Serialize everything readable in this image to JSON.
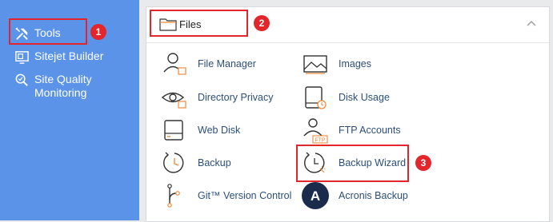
{
  "sidebar": {
    "items": [
      {
        "label": "Tools",
        "icon": "tools-icon"
      },
      {
        "label": "Sitejet Builder",
        "icon": "sitejet-icon"
      },
      {
        "label": "Site Quality Monitoring",
        "icon": "site-quality-icon"
      }
    ]
  },
  "panel": {
    "title": "Files",
    "tools_left": [
      {
        "label": "File Manager",
        "icon": "file-manager-icon"
      },
      {
        "label": "Directory Privacy",
        "icon": "directory-privacy-icon"
      },
      {
        "label": "Web Disk",
        "icon": "web-disk-icon"
      },
      {
        "label": "Backup",
        "icon": "backup-icon"
      },
      {
        "label": "Git™ Version Control",
        "icon": "git-icon"
      }
    ],
    "tools_right": [
      {
        "label": "Images",
        "icon": "images-icon"
      },
      {
        "label": "Disk Usage",
        "icon": "disk-usage-icon"
      },
      {
        "label": "FTP Accounts",
        "icon": "ftp-icon"
      },
      {
        "label": "Backup Wizard",
        "icon": "backup-wizard-icon"
      },
      {
        "label": "Acronis Backup",
        "icon": "acronis-icon",
        "icon_text": "A"
      }
    ]
  },
  "callouts": [
    "1",
    "2",
    "3"
  ],
  "colors": {
    "sidebar": "#5a93e8",
    "accent_orange": "#f08a3c",
    "callout_red": "#e2262b",
    "link": "#2b4f7a"
  }
}
